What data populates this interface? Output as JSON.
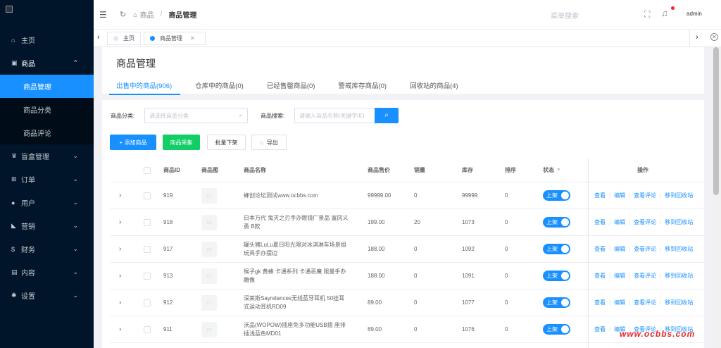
{
  "sidebar": {
    "items": [
      {
        "icon": "home-icon",
        "glyph": "⌂",
        "label": "主页"
      },
      {
        "icon": "shop-basket-icon",
        "glyph": "▣",
        "label": "商品",
        "expanded": true,
        "children": [
          {
            "label": "商品管理",
            "active": true
          },
          {
            "label": "商品分类"
          },
          {
            "label": "商品评论"
          }
        ]
      },
      {
        "icon": "trophy-icon",
        "glyph": "♛",
        "label": "盲盒管理"
      },
      {
        "icon": "cart-icon",
        "glyph": "⊞",
        "label": "订单"
      },
      {
        "icon": "user-icon",
        "glyph": "●",
        "label": "用户"
      },
      {
        "icon": "send-icon",
        "glyph": "◣",
        "label": "营销"
      },
      {
        "icon": "dollar-icon",
        "glyph": "$",
        "label": "财务"
      },
      {
        "icon": "book-icon",
        "glyph": "▤",
        "label": "内容"
      },
      {
        "icon": "gear-icon",
        "glyph": "✱",
        "label": "设置"
      }
    ]
  },
  "header": {
    "breadcrumb_parent": "商品",
    "breadcrumb_current": "商品管理",
    "search_placeholder": "菜单搜索",
    "user_name": "admin"
  },
  "tabs": {
    "home_label": "主页",
    "active_label": "商品管理",
    "close_glyph": "✕"
  },
  "page": {
    "title": "商品管理",
    "status_tabs": [
      "出售中的商品(906)",
      "仓库中的商品(0)",
      "已经售罄商品(0)",
      "警戒库存商品(0)",
      "回收站的商品(4)"
    ]
  },
  "filters": {
    "category_label": "商品分类:",
    "category_placeholder": "请选择商品分类",
    "search_label": "商品搜索:",
    "search_placeholder": "请输入商品名称/关键字/ID"
  },
  "buttons": {
    "add": "+ 添加商品",
    "collect": "商品采集",
    "off_shelf": "批量下架",
    "export": "导出"
  },
  "table": {
    "columns": {
      "id": "商品ID",
      "image": "商品图",
      "name": "商品名称",
      "price": "商品售价",
      "sales": "销量",
      "stock": "库存",
      "sort": "排序",
      "status": "状态",
      "ops": "操作"
    },
    "status_label": "上架",
    "ops": [
      "查看",
      "编辑",
      "查看评论",
      "移到回收站"
    ],
    "rows": [
      {
        "id": "919",
        "name": "蜂创论坛测试www.ocbbs.com",
        "price": "99999.00",
        "sales": "0",
        "stock": "99999",
        "sort": "0"
      },
      {
        "id": "918",
        "name": "日本万代 鬼灭之刃手办眼镜厂景品 富冈义勇 B款",
        "price": "199.00",
        "sales": "20",
        "stock": "1073",
        "sort": "0"
      },
      {
        "id": "917",
        "name": "罐头猪LuLu夏日阳光限对冰淇淋车场景组玩具手办摆边",
        "price": "188.00",
        "sales": "0",
        "stock": "1092",
        "sort": "0"
      },
      {
        "id": "913",
        "name": "猴子gk 黄蜂 卡通系列 卡通恶魔 限量手办雕像",
        "price": "188.00",
        "sales": "0",
        "stock": "1091",
        "sort": "0"
      },
      {
        "id": "912",
        "name": "深莱斯Sayrelances无线蓝牙耳机 50挂耳式运动耳机RD09",
        "price": "89.00",
        "sales": "0",
        "stock": "1077",
        "sort": "0"
      },
      {
        "id": "911",
        "name": "沃品(WOPOW)插座免多功能USB插 座排插浅蓝色MD01",
        "price": "89.00",
        "sales": "0",
        "stock": "1076",
        "sort": "0"
      }
    ]
  },
  "watermark": "www.ocbbs.com"
}
